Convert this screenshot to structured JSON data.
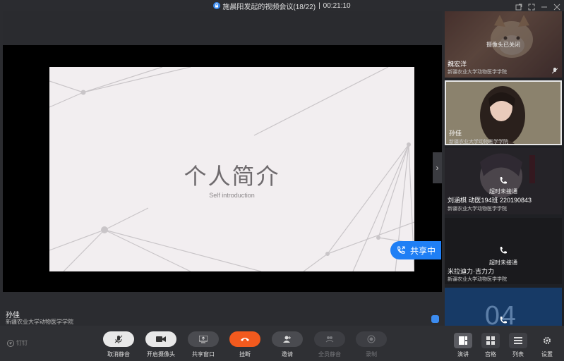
{
  "window": {
    "title": "施晨阳发起的视频会议(18/22)",
    "separator": "|",
    "timer": "00:21:10"
  },
  "slide": {
    "title": "个人简介",
    "subtitle": "Self introduction"
  },
  "share_badge": "共享中",
  "stage_speaker": {
    "name": "孙佳",
    "org": "新疆农业大学动物医学学院"
  },
  "participants": [
    {
      "name": "魏宏洋",
      "org": "新疆农业大学动物医学学院",
      "status": "摄像头已关闭",
      "phone": false
    },
    {
      "name": "孙佳",
      "org": "新疆农业大学动物医学学院",
      "status": "",
      "phone": false
    },
    {
      "name": "刘涵棋 动医194班 220190843",
      "org": "新疆农业大学动物医学学院",
      "status": "超时未接通",
      "phone": true
    },
    {
      "name": "米拉迪力·吉力力",
      "org": "新疆农业大学动物医学学院",
      "status": "超时未接通",
      "phone": true
    },
    {
      "name": "",
      "org": "",
      "status": "",
      "phone": true,
      "bg_text": "04"
    }
  ],
  "toolbar": {
    "brand": "钉钉",
    "unmute": "取消静音",
    "camera": "开启摄像头",
    "share": "共享窗口",
    "hangup": "挂断",
    "invite": "邀请",
    "mute_all": "全员静音",
    "record": "录制",
    "view_speaker": "演讲",
    "view_grid": "宫格",
    "view_list": "列表",
    "settings": "设置"
  },
  "colors": {
    "accent": "#1f7ff5",
    "hangup": "#f25a1e",
    "slide_bg": "#f2eef0"
  }
}
